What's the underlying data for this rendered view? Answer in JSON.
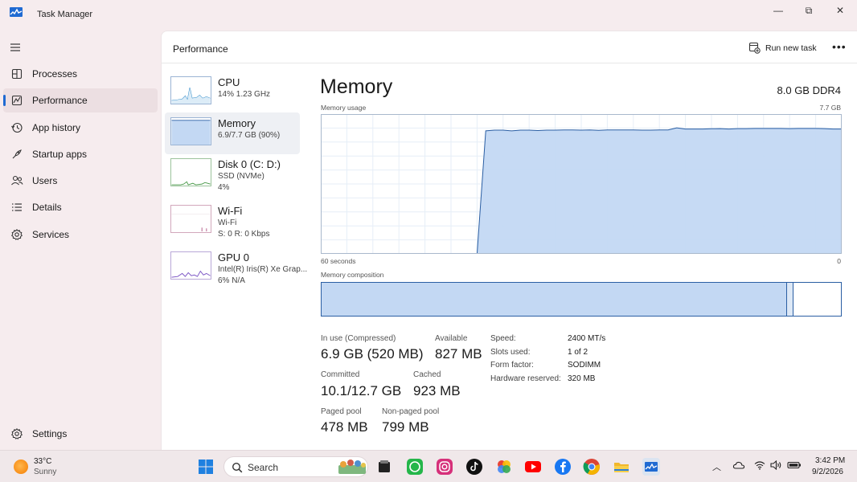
{
  "window": {
    "title": "Task Manager",
    "minimize": "—",
    "maximize": "⧉",
    "close": "✕"
  },
  "sidebar": {
    "items": [
      {
        "label": "Processes"
      },
      {
        "label": "Performance"
      },
      {
        "label": "App history"
      },
      {
        "label": "Startup apps"
      },
      {
        "label": "Users"
      },
      {
        "label": "Details"
      },
      {
        "label": "Services"
      }
    ],
    "settings": "Settings"
  },
  "header": {
    "title": "Performance",
    "run_task": "Run new task",
    "more": "•••"
  },
  "resources": [
    {
      "name": "CPU",
      "line1": "14%  1.23 GHz",
      "line2": ""
    },
    {
      "name": "Memory",
      "line1": "6.9/7.7 GB (90%)",
      "line2": ""
    },
    {
      "name": "Disk 0 (C: D:)",
      "line1": "SSD (NVMe)",
      "line2": "4%"
    },
    {
      "name": "Wi-Fi",
      "line1": "Wi-Fi",
      "line2": "S: 0  R: 0 Kbps"
    },
    {
      "name": "GPU 0",
      "line1": "Intel(R) Iris(R) Xe Grap...",
      "line2": "6%  N/A"
    }
  ],
  "memory": {
    "title": "Memory",
    "spec": "8.0 GB DDR4",
    "usage_label": "Memory usage",
    "usage_max": "7.7 GB",
    "time_left": "60 seconds",
    "time_right": "0",
    "composition_label": "Memory composition",
    "composition": {
      "in_use": 0.897,
      "modified": 0.012,
      "standby": 0.091
    },
    "graph": {
      "usage_fraction": [
        0,
        0,
        0,
        0,
        0,
        0,
        0,
        0,
        0,
        0,
        0,
        0,
        0,
        0,
        0,
        0,
        0,
        0,
        0,
        0.88,
        0.885,
        0.885,
        0.88,
        0.885,
        0.885,
        0.882,
        0.885,
        0.885,
        0.886,
        0.886,
        0.885,
        0.886,
        0.884,
        0.886,
        0.886,
        0.886,
        0.887,
        0.885,
        0.885,
        0.887,
        0.887,
        0.902,
        0.893,
        0.893,
        0.893,
        0.895,
        0.896,
        0.893,
        0.896,
        0.896,
        0.897,
        0.897,
        0.897,
        0.897,
        0.896,
        0.897,
        0.897,
        0.897,
        0.896,
        0.893,
        0.893
      ]
    },
    "stats": {
      "in_use_label": "In use (Compressed)",
      "in_use_value": "6.9 GB (520 MB)",
      "available_label": "Available",
      "available_value": "827 MB",
      "committed_label": "Committed",
      "committed_value": "10.1/12.7 GB",
      "cached_label": "Cached",
      "cached_value": "923 MB",
      "paged_label": "Paged pool",
      "paged_value": "478 MB",
      "nonpaged_label": "Non-paged pool",
      "nonpaged_value": "799 MB"
    },
    "specs": [
      {
        "label": "Speed:",
        "value": "2400 MT/s"
      },
      {
        "label": "Slots used:",
        "value": "1 of 2"
      },
      {
        "label": "Form factor:",
        "value": "SODIMM"
      },
      {
        "label": "Hardware reserved:",
        "value": "320 MB"
      }
    ]
  },
  "taskbar": {
    "weather_temp": "33°C",
    "weather_cond": "Sunny",
    "search_label": "Search",
    "time": "3:42 PM",
    "date": "9/2/2026"
  },
  "colors": {
    "accent": "#1f6ad2",
    "memory_fill": "#c3d8f3",
    "memory_line": "#2a5ea3",
    "grid": "#e6eef7"
  }
}
